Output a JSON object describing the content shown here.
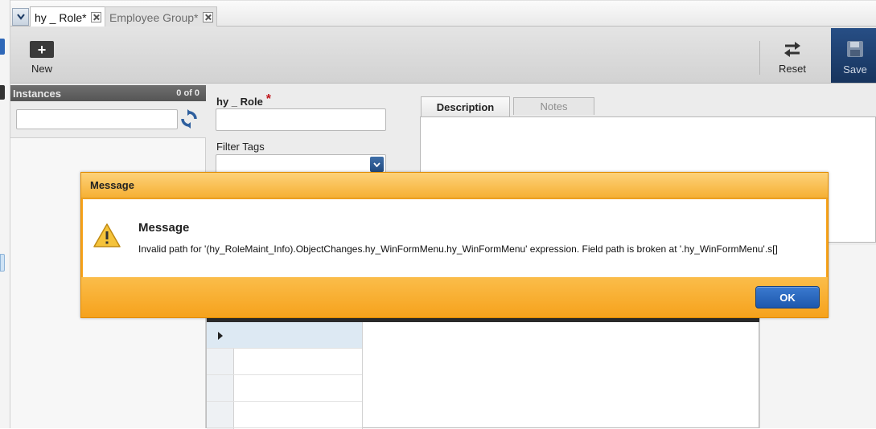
{
  "tabs": [
    {
      "label": "hy _ Role*",
      "active": true
    },
    {
      "label": "Employee Group*",
      "active": false
    }
  ],
  "toolbar": {
    "new_label": "New",
    "reset_label": "Reset",
    "save_label": "Save"
  },
  "instances": {
    "title": "Instances",
    "count": "0 of 0",
    "search_value": ""
  },
  "form": {
    "role_label": "hy _ Role",
    "required_mark": "*",
    "role_value": "",
    "filter_label": "Filter Tags",
    "filter_value": ""
  },
  "detail_tabs": [
    {
      "label": "Description",
      "active": true
    },
    {
      "label": "Notes",
      "active": false
    }
  ],
  "dialog": {
    "title": "Message",
    "heading": "Message",
    "text": "Invalid path for '(hy_RoleMaint_Info).ObjectChanges.hy_WinFormMenu.hy_WinFormMenu' expression. Field path is broken at '.hy_WinFormMenu'.s[]",
    "ok_label": "OK"
  },
  "colors": {
    "dialog_accent": "#f7a31c",
    "ok_button": "#1d58ad",
    "save_button": "#17345d",
    "required": "#c0141a"
  }
}
